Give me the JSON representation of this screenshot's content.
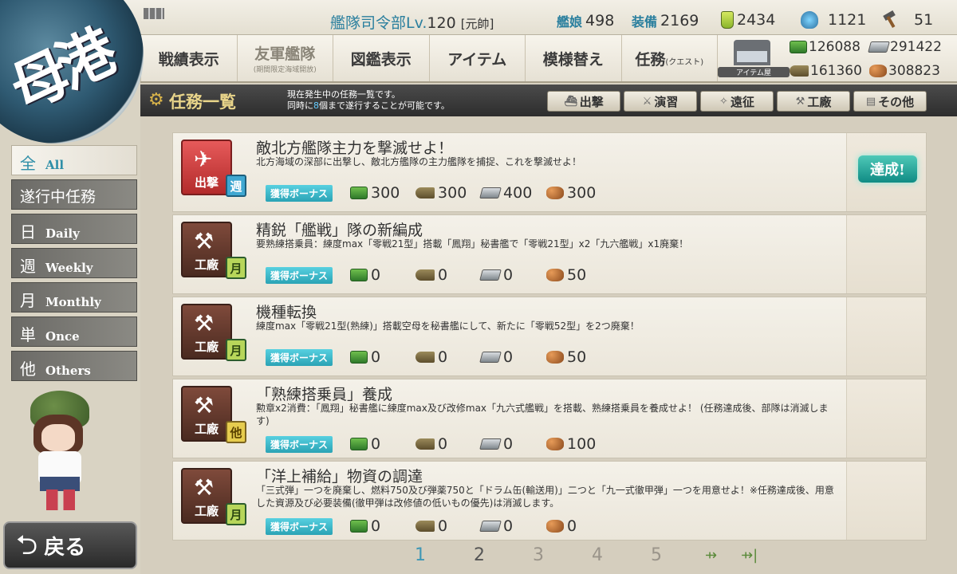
{
  "header": {
    "hq_label": "艦隊司令部",
    "hq_lv_label": "Lv.",
    "hq_level": "120",
    "rank": "[元帥]",
    "ships_label": "艦娘",
    "ships_count": "498",
    "equip_label": "装備",
    "equip_count": "2169",
    "bucket": "2434",
    "flamethrower": "1121",
    "devmat": "51"
  },
  "nav": {
    "items": [
      {
        "label": "戦績表示"
      },
      {
        "label": "友軍艦隊",
        "sub": "(期間限定海域開放)"
      },
      {
        "label": "図鑑表示"
      },
      {
        "label": "アイテム"
      },
      {
        "label": "模様替え"
      },
      {
        "label": "任務",
        "sub": "(クエスト)"
      }
    ],
    "shop_label": "アイテム屋"
  },
  "resources": {
    "fuel": "126088",
    "steel": "291422",
    "ammo": "161360",
    "bauxite": "308823"
  },
  "titlebar": {
    "title": "任務一覧",
    "desc1": "現在発生中の任務一覧です。",
    "desc2a": "同時に",
    "desc2b": "8",
    "desc2c": "個まで遂行することが可能です。",
    "tabs": [
      "出撃",
      "演習",
      "遠征",
      "工廠",
      "その他"
    ]
  },
  "filters": [
    {
      "big": "全",
      "small": "All"
    },
    {
      "big": "遂行中任務",
      "small": ""
    },
    {
      "big": "日",
      "small": "Daily"
    },
    {
      "big": "週",
      "small": "Weekly"
    },
    {
      "big": "月",
      "small": "Monthly"
    },
    {
      "big": "単",
      "small": "Once"
    },
    {
      "big": "他",
      "small": "Others"
    }
  ],
  "back_label": "戻る",
  "bonus_label": "獲得ボーナス",
  "quests": [
    {
      "category": "出撃",
      "freq": "週",
      "title": "敵北方艦隊主力を撃滅せよ！",
      "desc": "北方海域の深部に出撃し、敵北方艦隊の主力艦隊を捕捉、これを撃滅せよ！",
      "fuel": "300",
      "ammo": "300",
      "steel": "400",
      "bauxite": "300",
      "status": "達成!"
    },
    {
      "category": "工廠",
      "freq": "月",
      "title": "精鋭「艦戦」隊の新編成",
      "desc": "要熟練搭乗員：練度max「零戦21型」搭載「鳳翔」秘書艦で「零戦21型」x2「九六艦戦」x1廃棄！",
      "fuel": "0",
      "ammo": "0",
      "steel": "0",
      "bauxite": "50"
    },
    {
      "category": "工廠",
      "freq": "月",
      "title": "機種転換",
      "desc": "練度max「零戦21型(熟練)」搭載空母を秘書艦にして、新たに「零戦52型」を2つ廃棄！",
      "fuel": "0",
      "ammo": "0",
      "steel": "0",
      "bauxite": "50"
    },
    {
      "category": "工廠",
      "freq": "他",
      "title": "「熟練搭乗員」養成",
      "desc": "勲章x2消費：「鳳翔」秘書艦に練度max及び改修max「九六式艦戦」を搭載、熟練搭乗員を養成せよ！ (任務達成後、部隊は消滅します)",
      "fuel": "0",
      "ammo": "0",
      "steel": "0",
      "bauxite": "100"
    },
    {
      "category": "工廠",
      "freq": "月",
      "title": "「洋上補給」物資の調達",
      "desc": "「三式弾」一つを廃棄し、燃料750及び弾薬750と「ドラム缶(輸送用)」二つと「九一式徹甲弾」一つを用意せよ！※任務達成後、用意した資源及び必要装備(徹甲弾は改修値の低いもの優先)は消滅します。",
      "fuel": "0",
      "ammo": "0",
      "steel": "0",
      "bauxite": "0"
    }
  ],
  "pager": {
    "pages": [
      "1",
      "2",
      "3",
      "4",
      "5"
    ],
    "current": "1",
    "next_icon": "next-page-icon",
    "last_icon": "last-page-icon"
  },
  "colors": {
    "accent_teal": "#2aa3b5",
    "page_current": "#3f97b5",
    "sortie_red": "#d84646",
    "arsenal_brown": "#6b3d30"
  }
}
